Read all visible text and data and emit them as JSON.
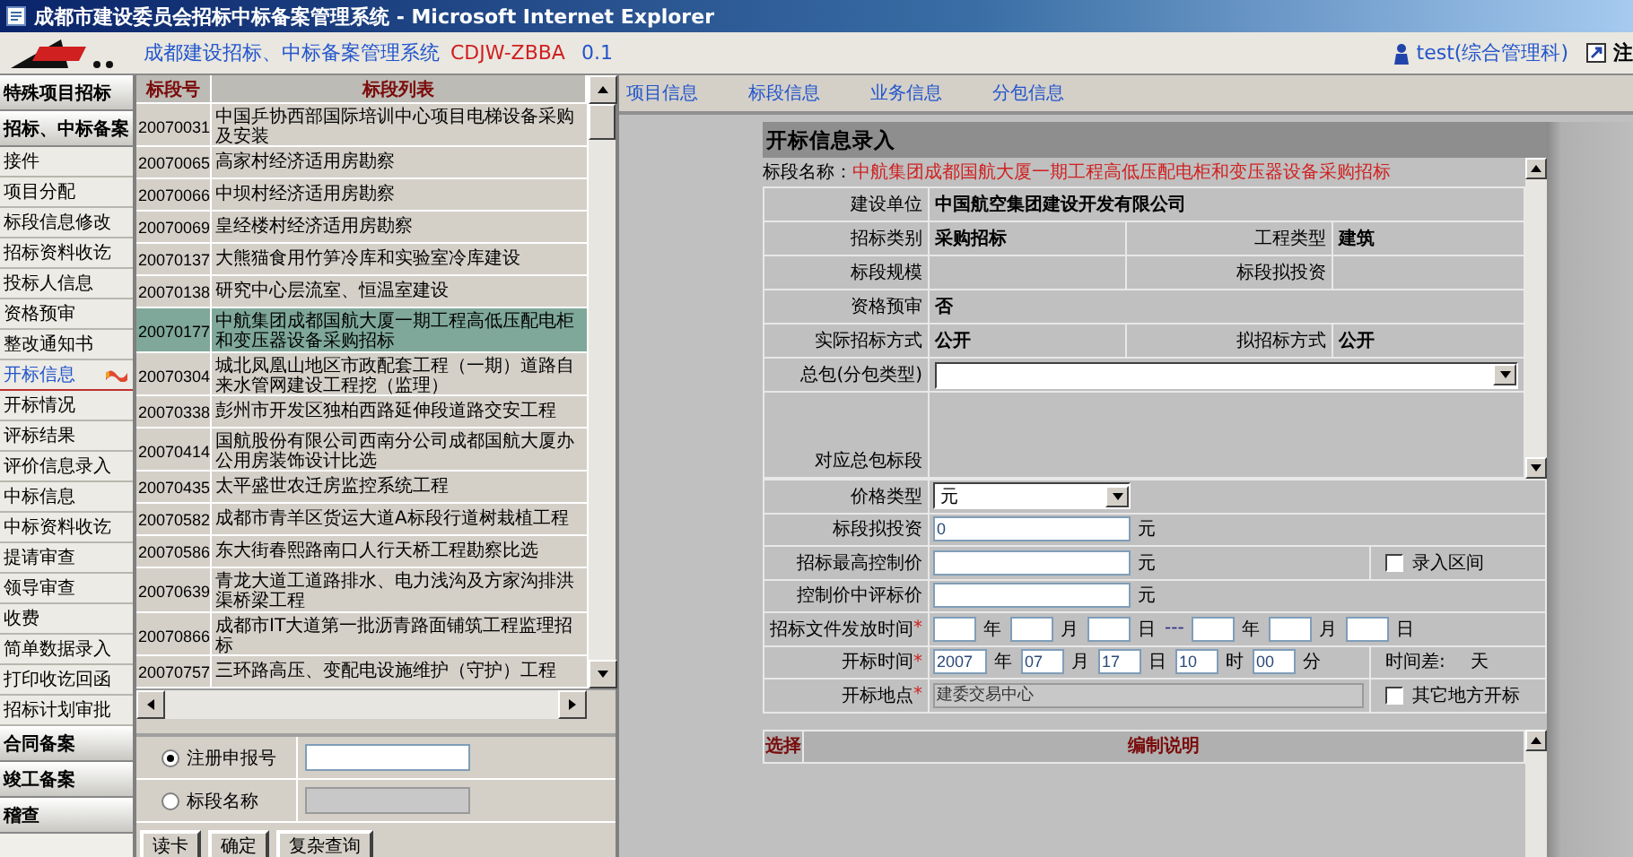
{
  "window": {
    "title": "成都市建设委员会招标中标备案管理系统 - Microsoft Internet Explorer"
  },
  "header": {
    "app_name": "成都建设招标、中标备案管理系统",
    "app_code": "CDJW-ZBBA",
    "version": "0.1",
    "user": "test(综合管理科)",
    "logout": "注"
  },
  "sidebar": {
    "sections": [
      {
        "label": "特殊项目招标"
      },
      {
        "label": "招标、中标备案",
        "items": [
          {
            "label": "接件",
            "selected": false
          },
          {
            "label": "项目分配",
            "selected": false
          },
          {
            "label": "标段信息修改",
            "selected": false
          },
          {
            "label": "招标资料收讫",
            "selected": false
          },
          {
            "label": "投标人信息",
            "selected": false
          },
          {
            "label": "资格预审",
            "selected": false
          },
          {
            "label": "整改通知书",
            "selected": false
          },
          {
            "label": "开标信息",
            "selected": true
          },
          {
            "label": "开标情况",
            "selected": false
          },
          {
            "label": "评标结果",
            "selected": false
          },
          {
            "label": "评价信息录入",
            "selected": false
          },
          {
            "label": "中标信息",
            "selected": false
          },
          {
            "label": "中标资料收讫",
            "selected": false
          },
          {
            "label": "提请审查",
            "selected": false
          },
          {
            "label": "领导审查",
            "selected": false
          },
          {
            "label": "收费",
            "selected": false
          },
          {
            "label": "简单数据录入",
            "selected": false
          },
          {
            "label": "打印收讫回函",
            "selected": false
          },
          {
            "label": "招标计划审批",
            "selected": false
          }
        ]
      },
      {
        "label": "合同备案"
      },
      {
        "label": "竣工备案"
      },
      {
        "label": "稽查"
      }
    ]
  },
  "segment_list": {
    "columns": [
      "标段号",
      "标段列表"
    ],
    "rows": [
      {
        "number": "20070031",
        "name": "中国乒协西部国际培训中心项目电梯设备采购及安装",
        "selected": false
      },
      {
        "number": "20070065",
        "name": "高家村经济适用房勘察",
        "selected": false
      },
      {
        "number": "20070066",
        "name": "中坝村经济适用房勘察",
        "selected": false
      },
      {
        "number": "20070069",
        "name": "皇经楼村经济适用房勘察",
        "selected": false
      },
      {
        "number": "20070137",
        "name": "大熊猫食用竹笋冷库和实验室冷库建设",
        "selected": false
      },
      {
        "number": "20070138",
        "name": "研究中心层流室、恒温室建设",
        "selected": false
      },
      {
        "number": "20070177",
        "name": "中航集团成都国航大厦一期工程高低压配电柜和变压器设备采购招标",
        "selected": true
      },
      {
        "number": "20070304",
        "name": "城北凤凰山地区市政配套工程（一期）道路自来水管网建设工程挖（监理）",
        "selected": false
      },
      {
        "number": "20070338",
        "name": "彭州市开发区独柏西路延伸段道路交安工程",
        "selected": false
      },
      {
        "number": "20070414",
        "name": "国航股份有限公司西南分公司成都国航大厦办公用房装饰设计比选",
        "selected": false
      },
      {
        "number": "20070435",
        "name": "太平盛世农迁房监控系统工程",
        "selected": false
      },
      {
        "number": "20070582",
        "name": "成都市青羊区货运大道A标段行道树栽植工程",
        "selected": false
      },
      {
        "number": "20070586",
        "name": "东大街春熙路南口人行天桥工程勘察比选",
        "selected": false
      },
      {
        "number": "20070639",
        "name": "青龙大道工道路排水、电力浅沟及方家沟排洪渠桥梁工程",
        "selected": false
      },
      {
        "number": "20070866",
        "name": "成都市IT大道第一批沥青路面铺筑工程监理招标",
        "selected": false
      },
      {
        "number": "20070757",
        "name": "三环路高压、变配电设施维护（守护）工程",
        "selected": false
      }
    ]
  },
  "search": {
    "options": [
      {
        "label": "注册申报号",
        "selected": true,
        "disabled": false
      },
      {
        "label": "标段名称",
        "selected": false,
        "disabled": true
      }
    ],
    "buttons": [
      "读卡",
      "确定",
      "复杂查询"
    ]
  },
  "tabs": [
    "项目信息",
    "标段信息",
    "业务信息",
    "分包信息"
  ],
  "form": {
    "title": "开标信息录入",
    "segment_label": "标段名称：",
    "segment_name": "中航集团成都国航大厦一期工程高低压配电柜和变压器设备采购招标",
    "info_rows": [
      {
        "kind": "pairs",
        "cells": [
          {
            "label": "建设单位",
            "value": "中国航空集团建设开发有限公司"
          }
        ]
      },
      {
        "kind": "pairs",
        "cells": [
          {
            "label": "招标类别",
            "value": "采购招标"
          },
          {
            "label": "工程类型",
            "value": "建筑"
          }
        ]
      },
      {
        "kind": "pairs",
        "cells": [
          {
            "label": "标段规模"
          },
          {
            "label": "标段拟投资"
          }
        ]
      },
      {
        "kind": "pairs",
        "cells": [
          {
            "label": "资格预审",
            "value": "否"
          }
        ]
      },
      {
        "kind": "pairs",
        "cells": [
          {
            "label": "实际招标方式",
            "value": "公开"
          },
          {
            "label": "拟招标方式",
            "value": "公开"
          }
        ]
      },
      {
        "kind": "select",
        "label": "总包(分包类型)"
      },
      {
        "kind": "area",
        "label": "对应总包标段"
      }
    ],
    "entry_rows": [
      {
        "kind": "select",
        "label": "价格类型",
        "value": "元"
      },
      {
        "kind": "amount",
        "label": "标段拟投资",
        "value": "0",
        "unit": "元"
      },
      {
        "kind": "amount",
        "label": "招标最高控制价",
        "unit": "元",
        "option": {
          "label": "录入区间",
          "checked": false
        }
      },
      {
        "kind": "amount",
        "label": "控制价中评标价",
        "unit": "元"
      },
      {
        "kind": "dates",
        "label": "招标文件发放时间",
        "mark": "*",
        "parts": [
          {
            "unit": "年"
          },
          {
            "unit": "月"
          },
          {
            "unit": "日",
            "after": "---"
          },
          {
            "unit": "年"
          },
          {
            "unit": "月"
          },
          {
            "unit": "日"
          }
        ]
      },
      {
        "kind": "dates",
        "label": "开标时间",
        "mark": "*",
        "parts": [
          {
            "value": "2007",
            "unit": "年"
          },
          {
            "value": "07",
            "unit": "月"
          },
          {
            "value": "17",
            "unit": "日"
          },
          {
            "value": "10",
            "unit": "时"
          },
          {
            "value": "00",
            "unit": "分"
          }
        ],
        "note": "时间差:",
        "note_unit": "天"
      },
      {
        "kind": "text",
        "label": "开标地点",
        "mark": "*",
        "value": "建委交易中心",
        "disabled": true,
        "option": {
          "label": "其它地方开标",
          "checked": false
        }
      }
    ]
  },
  "notes_table": {
    "columns": [
      "选择",
      "编制说明"
    ]
  }
}
